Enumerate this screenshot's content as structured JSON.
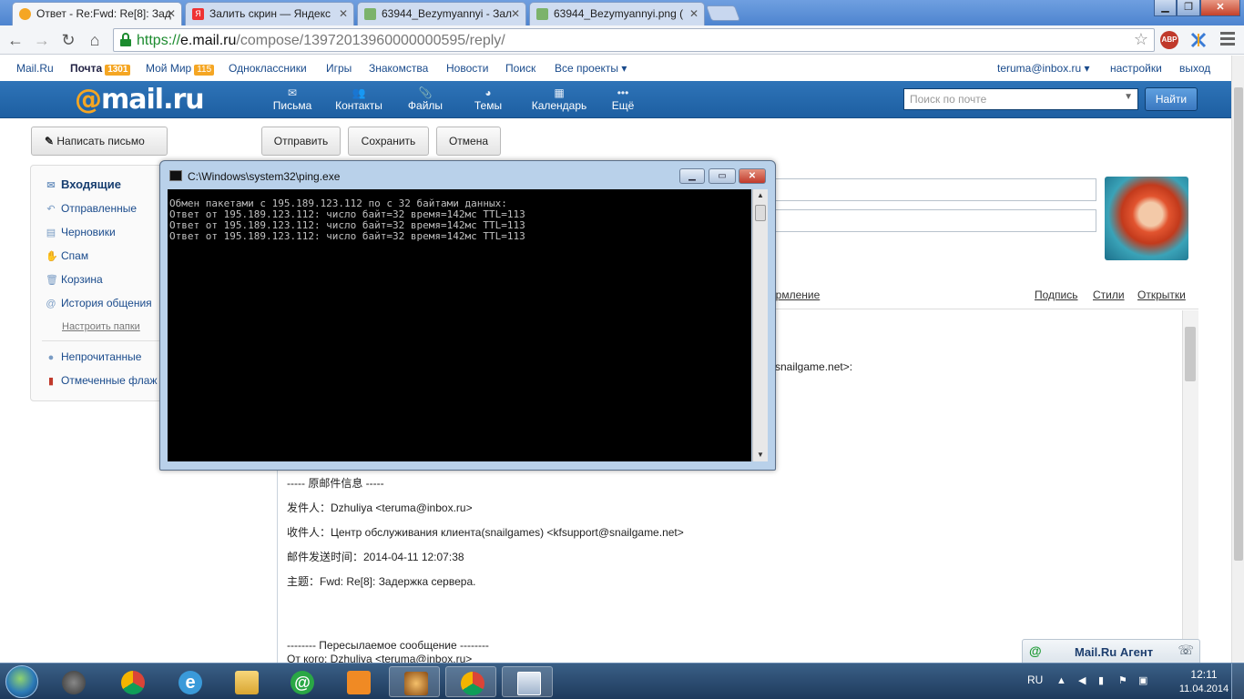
{
  "browser": {
    "tabs": [
      {
        "label": "Ответ - Re:Fwd: Re[8]: Зад",
        "icon": "mailru-favicon",
        "active": true
      },
      {
        "label": "Залить скрин — Яндекс",
        "icon": "yandex-favicon",
        "active": false
      },
      {
        "label": "63944_Bezymyannyi - Зал",
        "icon": "image-favicon",
        "active": false
      },
      {
        "label": "63944_Bezymyannyi.png (",
        "icon": "image-favicon",
        "active": false
      }
    ],
    "url": {
      "scheme": "https://",
      "host": "e.mail.ru",
      "path": "/compose/13972013960000000595/reply/"
    },
    "extensions": [
      {
        "label": "ABP",
        "color": "#c0392b"
      },
      {
        "label": "",
        "color": "#3a7bd5"
      }
    ]
  },
  "portal_nav": {
    "items": [
      "Mail.Ru",
      "Почта",
      "Мой Мир",
      "Одноклассники",
      "Игры",
      "Знакомства",
      "Новости",
      "Поиск",
      "Все проекты ▾"
    ],
    "mail_count": "1301",
    "world_count": "115",
    "user": "teruma@inbox.ru ▾",
    "settings": "настройки",
    "logout": "выход"
  },
  "mail_header": {
    "logo_at": "@",
    "logo_text": "mail.ru",
    "nav": [
      {
        "label": "Письма",
        "icon": "envelope-icon"
      },
      {
        "label": "Контакты",
        "icon": "contacts-icon"
      },
      {
        "label": "Файлы",
        "icon": "paperclip-icon"
      },
      {
        "label": "Темы",
        "icon": "palette-icon"
      },
      {
        "label": "Календарь",
        "icon": "calendar-icon"
      },
      {
        "label": "Ещё",
        "icon": "more-dots-icon"
      }
    ],
    "search_placeholder": "Поиск по почте",
    "search_button": "Найти"
  },
  "actions": {
    "compose": "Написать письмо",
    "send": "Отправить",
    "save": "Сохранить",
    "cancel": "Отмена"
  },
  "folders": {
    "items": [
      {
        "label": "Входящие",
        "icon": "inbox-icon",
        "selected": true
      },
      {
        "label": "Отправленные",
        "icon": "sent-icon"
      },
      {
        "label": "Черновики",
        "icon": "drafts-icon"
      },
      {
        "label": "Спам",
        "icon": "spam-icon"
      },
      {
        "label": "Корзина",
        "icon": "trash-icon"
      },
      {
        "label": "История общения",
        "icon": "history-icon"
      }
    ],
    "configure": "Настроить папки",
    "extra": [
      {
        "label": "Непрочитанные",
        "icon": "unread-dot-icon"
      },
      {
        "label": "Отмеченные флаж",
        "icon": "flag-icon"
      }
    ]
  },
  "format_bar": {
    "left": "ормление",
    "signature": "Подпись",
    "styles": "Стили",
    "postcards": "Открытки"
  },
  "editor": {
    "partial_line": "snailgame.net>:",
    "lines": [
      "----- 原邮件信息 -----",
      "发件人：Dzhuliya <teruma@inbox.ru>",
      "收件人：Центр обслуживания клиента(snailgames) <kfsupport@snailgame.net>",
      "邮件发送时间：2014-04-11 12:07:38",
      "主题：Fwd: Re[8]: Задержка сервера.",
      "-------- Пересылаемое сообщение --------",
      "От кого: Dzhuliya <teruma@inbox.ru>"
    ]
  },
  "agent": {
    "label": "Mail.Ru Агент"
  },
  "cmd": {
    "title": "C:\\Windows\\system32\\ping.exe",
    "output": [
      "Обмен пакетами с 195.189.123.112 по с 32 байтами данных:",
      "Ответ от 195.189.123.112: число байт=32 время=142мс TTL=113",
      "Ответ от 195.189.123.112: число байт=32 время=142мс TTL=113",
      "Ответ от 195.189.123.112: число байт=32 время=142мс TTL=113"
    ]
  },
  "taskbar": {
    "apps": [
      "media-player-icon",
      "chrome-icon",
      "internet-explorer-icon",
      "explorer-icon",
      "mail-agent-icon",
      "media-icon",
      "game-icon",
      "chrome-icon",
      "window-icon"
    ],
    "lang": "RU",
    "time": "12:11",
    "date": "11.04.2014"
  }
}
